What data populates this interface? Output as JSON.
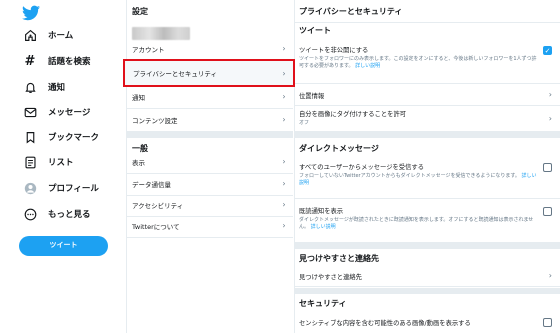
{
  "nav": {
    "logo_icon": "twitter-bird-icon",
    "items": [
      {
        "label": "ホーム",
        "icon": "home-icon"
      },
      {
        "label": "話題を検索",
        "icon": "hashtag-icon"
      },
      {
        "label": "通知",
        "icon": "bell-icon"
      },
      {
        "label": "メッセージ",
        "icon": "mail-icon"
      },
      {
        "label": "ブックマーク",
        "icon": "bookmark-icon"
      },
      {
        "label": "リスト",
        "icon": "list-icon"
      },
      {
        "label": "プロフィール",
        "icon": "profile-icon"
      },
      {
        "label": "もっと見る",
        "icon": "more-icon"
      }
    ],
    "tweet_button": "ツイート",
    "accent": "#1da1f2"
  },
  "settings": {
    "title": "設定",
    "items": [
      {
        "label": "アカウント"
      },
      {
        "label": "プライバシーとセキュリティ"
      },
      {
        "label": "通知"
      },
      {
        "label": "コンテンツ設定"
      }
    ],
    "general_title": "一般",
    "general_items": [
      {
        "label": "表示"
      },
      {
        "label": "データ通信量"
      },
      {
        "label": "アクセシビリティ"
      },
      {
        "label": "Twitterについて"
      }
    ],
    "highlight_color": "#e0101a"
  },
  "detail": {
    "title": "プライバシーとセキュリティ",
    "tweet_section": "ツイート",
    "protect": {
      "title": "ツイートを非公開にする",
      "desc": "ツイートをフォロワーにのみ表示します。この設定をオンにすると、今後は新しいフォロワーを1人ずつ許可する必要があります。",
      "link": "詳しい説明",
      "checked": true
    },
    "location": {
      "title": "位置情報"
    },
    "photo_tag": {
      "title": "自分を画像にタグ付けすることを許可",
      "sub": "オフ"
    },
    "dm_section": "ダイレクトメッセージ",
    "dm_all": {
      "title": "すべてのユーザーからメッセージを受信する",
      "desc": "フォローしていないTwitterアカウントからもダイレクトメッセージを受信できるようになります。",
      "link": "詳しい説明",
      "checked": false
    },
    "read_receipts": {
      "title": "既読通知を表示",
      "desc": "ダイレクトメッセージが既読されたときに既読通知を表示します。オフにすると既読通知は表示されません。",
      "link": "詳しい説明",
      "checked": false
    },
    "discover_section": "見つけやすさと連絡先",
    "discover": {
      "title": "見つけやすさと連絡先"
    },
    "security_section": "セキュリティ",
    "sensitive": {
      "title": "センシティブな内容を含む可能性のある画像/動画を表示する",
      "checked": false
    }
  }
}
